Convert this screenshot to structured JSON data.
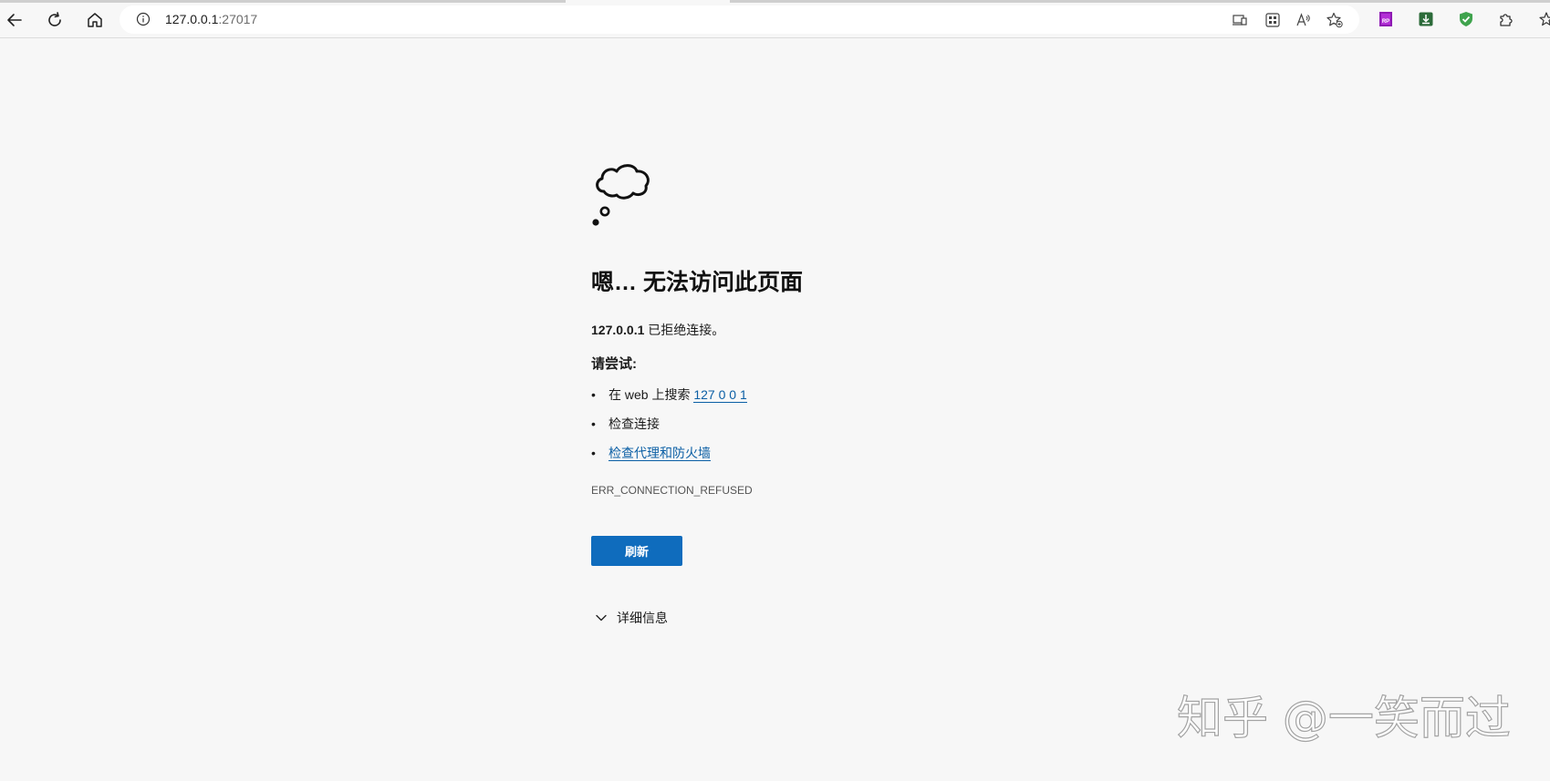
{
  "browser": {
    "url_host": "127.0.0.1",
    "url_port": ":27017",
    "back_icon": "back-arrow-icon",
    "reload_icon": "reload-icon",
    "home_icon": "home-icon",
    "site_info_icon": "info-icon",
    "address_icons": [
      "app-available-icon",
      "qr-code-icon",
      "read-aloud-icon",
      "add-favorite-icon"
    ],
    "extensions": [
      "axure-rp-extension-icon",
      "download-extension-icon",
      "shield-extension-icon",
      "extensions-puzzle-icon",
      "favorites-icon"
    ]
  },
  "error_page": {
    "icon": "thought-cloud-icon",
    "title": "嗯… 无法访问此页面",
    "desc_host": "127.0.0.1",
    "desc_text": " 已拒绝连接。",
    "try_label": "请尝试:",
    "suggestions": {
      "search_prefix": "在 web 上搜索 ",
      "search_link": "127 0 0 1",
      "check_connection": "检查连接",
      "check_proxy_link": "检查代理和防火墙"
    },
    "bullet": "•",
    "error_code": "ERR_CONNECTION_REFUSED",
    "refresh_button": "刷新",
    "details_label": "详细信息"
  },
  "watermark": "知乎 @一笑而过",
  "colors": {
    "page_background": "#f7f7f7",
    "accent": "#0f6cbd",
    "link": "#0b5fa5"
  }
}
